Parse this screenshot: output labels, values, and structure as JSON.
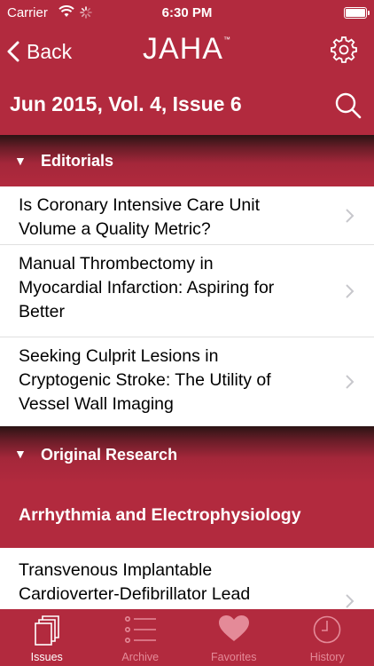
{
  "status_bar": {
    "carrier": "Carrier",
    "time": "6:30 PM"
  },
  "nav": {
    "back_label": "Back",
    "title": "JAHA",
    "title_mark": "™"
  },
  "issue": {
    "title": "Jun 2015, Vol. 4, Issue 6"
  },
  "sections": [
    {
      "label": "Editorials",
      "items": [
        {
          "lines": [
            "Is Coronary Intensive Care Unit",
            "Volume a Quality Metric?"
          ]
        },
        {
          "lines": [
            "Manual Thrombectomy in",
            "Myocardial Infarction: Aspiring for",
            "Better"
          ]
        },
        {
          "lines": [
            "Seeking Culprit Lesions in",
            "Cryptogenic Stroke: The Utility of",
            "Vessel Wall Imaging"
          ]
        }
      ]
    },
    {
      "label": "Original Research",
      "subsection": "Arrhythmia and Electrophysiology",
      "items": [
        {
          "lines": [
            "Transvenous Implantable",
            "Cardioverter-Defibrillator Lead"
          ]
        }
      ]
    }
  ],
  "tabs": [
    {
      "label": "Issues",
      "icon": "issues-icon",
      "active": true
    },
    {
      "label": "Archive",
      "icon": "archive-icon",
      "active": false
    },
    {
      "label": "Favorites",
      "icon": "heart-icon",
      "active": false
    },
    {
      "label": "History",
      "icon": "clock-icon",
      "active": false
    }
  ],
  "colors": {
    "brand": "#b22a3e",
    "inactive_tab": "#e48a98",
    "chevron": "#c7c7cc"
  }
}
